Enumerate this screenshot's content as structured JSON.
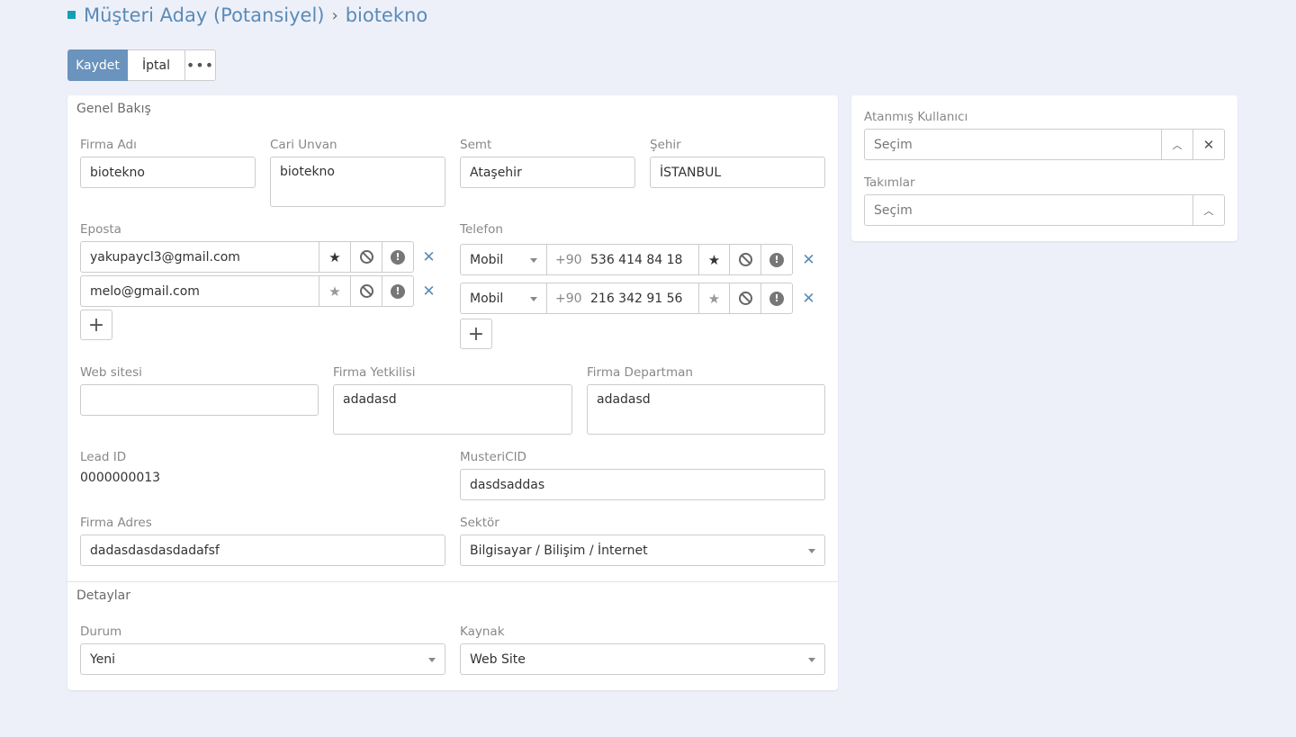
{
  "header": {
    "module": "Müşteri Aday (Potansiyel)",
    "separator": "›",
    "record": "biotekno"
  },
  "toolbar": {
    "save_label": "Kaydet",
    "cancel_label": "İptal",
    "more_label": "•••"
  },
  "overview": {
    "title": "Genel Bakış",
    "firma_adi": {
      "label": "Firma Adı",
      "value": "biotekno"
    },
    "cari_unvan": {
      "label": "Cari Unvan",
      "value": "biotekno"
    },
    "semt": {
      "label": "Semt",
      "value": "Ataşehir"
    },
    "sehir": {
      "label": "Şehir",
      "value": "İSTANBUL"
    },
    "eposta": {
      "label": "Eposta",
      "items": [
        {
          "value": "yakupaycl3@gmail.com",
          "primary": true
        },
        {
          "value": "melo@gmail.com",
          "primary": false
        }
      ]
    },
    "telefon": {
      "label": "Telefon",
      "items": [
        {
          "type": "Mobil",
          "code": "+90",
          "number": "536 414 84 18",
          "primary": true
        },
        {
          "type": "Mobil",
          "code": "+90",
          "number": "216 342 91 56",
          "primary": false
        }
      ]
    },
    "web_sitesi": {
      "label": "Web sitesi",
      "value": ""
    },
    "firma_yetkilisi": {
      "label": "Firma Yetkilisi",
      "value": "adadasd"
    },
    "firma_departman": {
      "label": "Firma Departman",
      "value": "adadasd"
    },
    "lead_id": {
      "label": "Lead ID",
      "value": "0000000013"
    },
    "musteri_cid": {
      "label": "MusteriCID",
      "value": "dasdsaddas"
    },
    "firma_adres": {
      "label": "Firma Adres",
      "value": "dadasdasdasdadafsf"
    },
    "sektor": {
      "label": "Sektör",
      "value": "Bilgisayar / Bilişim / İnternet"
    }
  },
  "details": {
    "title": "Detaylar",
    "durum": {
      "label": "Durum",
      "value": "Yeni"
    },
    "kaynak": {
      "label": "Kaynak",
      "value": "Web Site"
    }
  },
  "side": {
    "assigned_user": {
      "label": "Atanmış Kullanıcı",
      "placeholder": "Seçim"
    },
    "teams": {
      "label": "Takımlar",
      "placeholder": "Seçim"
    }
  },
  "colors": {
    "accent": "#6a93bd",
    "link": "#5a8bb7",
    "background": "#eef0f9",
    "header_square": "#14a0b4"
  }
}
